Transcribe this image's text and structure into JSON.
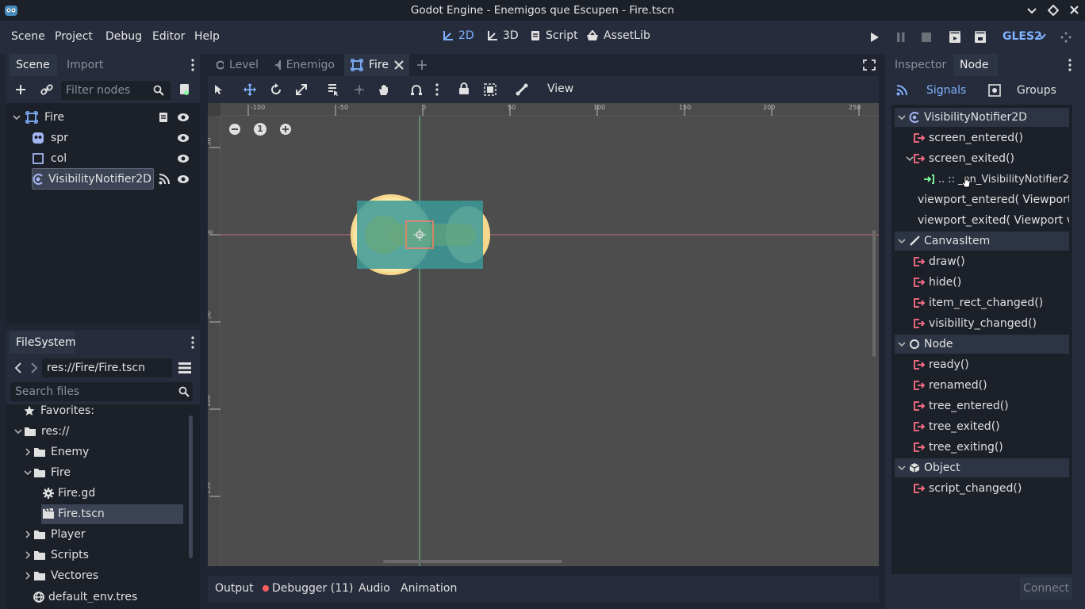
{
  "title": "Godot Engine - Enemigos que Escupen - Fire.tscn",
  "menu": [
    "Scene",
    "Project",
    "Debug",
    "Editor",
    "Help"
  ],
  "workspaces": {
    "w2d": "2D",
    "w3d": "3D",
    "script": "Script",
    "assetlib": "AssetLib"
  },
  "renderer": "GLES2",
  "scene_tabs": {
    "scene": "Scene",
    "import": "Import"
  },
  "filter_placeholder": "Filter nodes",
  "scene_tree": [
    {
      "name": "Fire",
      "icon": "node2d-icon"
    },
    {
      "name": "spr",
      "icon": "sprite-icon"
    },
    {
      "name": "col",
      "icon": "collision-shape-icon"
    },
    {
      "name": "VisibilityNotifier2D",
      "icon": "visibility-notifier-icon"
    }
  ],
  "editor_tabs": [
    "Level",
    "Enemigo",
    "Fire"
  ],
  "view_menu": "View",
  "zoom_reset": "1",
  "ruler_h": [
    "-100",
    "-50",
    "0",
    "50",
    "100",
    "150",
    "200",
    "250"
  ],
  "ruler_v": [
    "50",
    "0",
    "50",
    "100",
    "150"
  ],
  "filesystem": {
    "title": "FileSystem",
    "path": "res://Fire/Fire.tscn",
    "search_placeholder": "Search files",
    "items": [
      "Favorites:",
      "res://",
      "Enemy",
      "Fire",
      "Fire.gd",
      "Fire.tscn",
      "Player",
      "Scripts",
      "Vectores",
      "default_env.tres"
    ]
  },
  "bottom_tabs": {
    "output": "Output",
    "debugger": "Debugger (11)",
    "audio": "Audio",
    "animation": "Animation"
  },
  "right_tabs": {
    "inspector": "Inspector",
    "node": "Node"
  },
  "node_tabs": {
    "signals": "Signals",
    "groups": "Groups"
  },
  "signals": {
    "visnotifier": "VisibilityNotifier2D",
    "screen_entered": "screen_entered()",
    "screen_exited": "screen_exited()",
    "connection": ".. :: _on_VisibilityNotifier2",
    "viewport_entered": "viewport_entered( Viewport",
    "viewport_exited": "viewport_exited( Viewport v",
    "canvasitem": "CanvasItem",
    "draw": "draw()",
    "hide": "hide()",
    "item_rect_changed": "item_rect_changed()",
    "visibility_changed": "visibility_changed()",
    "node": "Node",
    "ready": "ready()",
    "renamed": "renamed()",
    "tree_entered": "tree_entered()",
    "tree_exited": "tree_exited()",
    "tree_exiting": "tree_exiting()",
    "object": "Object",
    "script_changed": "script_changed()"
  },
  "connect_label": "Connect",
  "colors": {
    "accent": "#80b2ff",
    "signal": "#ff7085",
    "bg": "#202531"
  }
}
